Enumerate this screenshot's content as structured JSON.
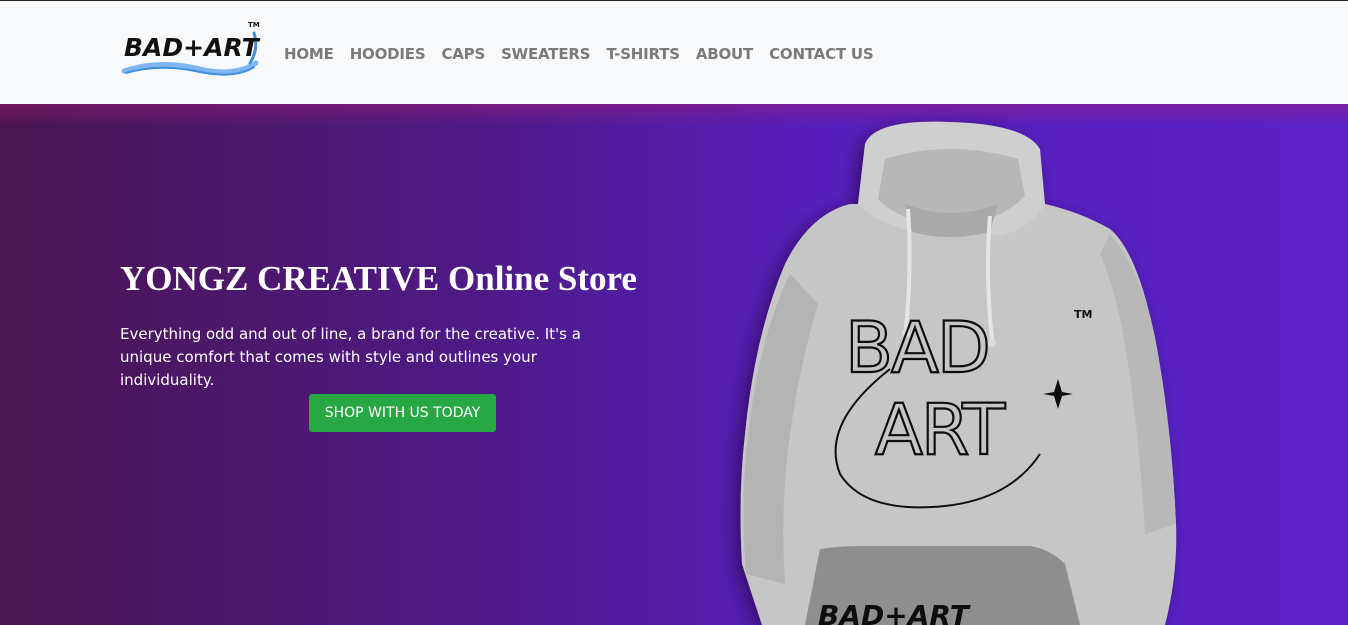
{
  "brand": {
    "logo_text": "BAD+ART",
    "trademark": "TM",
    "logo_color": "#111111",
    "swoosh_color": "#3f8fe0"
  },
  "nav": {
    "items": [
      {
        "label": "HOME"
      },
      {
        "label": "HOODIES"
      },
      {
        "label": "CAPS"
      },
      {
        "label": "SWEATERS"
      },
      {
        "label": "T-SHIRTS"
      },
      {
        "label": "ABOUT"
      },
      {
        "label": "CONTACT US"
      }
    ]
  },
  "hero": {
    "title": "YONGZ CREATIVE Online Store",
    "description": "Everything odd and out of line, a brand for the creative. It's a unique comfort that comes with style and outlines your individuality.",
    "cta_label": "SHOP WITH US TODAY",
    "cta_color": "#28a745",
    "gradient_colors": [
      "#4a1550",
      "#4e1a86",
      "#561fbb",
      "#5a21c7"
    ]
  },
  "product_image": {
    "icon": "hoodie-icon",
    "print_line1": "BAD",
    "print_line2": "ART",
    "print_trademark": "TM",
    "pocket_text": "BAD+ART",
    "garment_color": "#c8c8c8"
  }
}
